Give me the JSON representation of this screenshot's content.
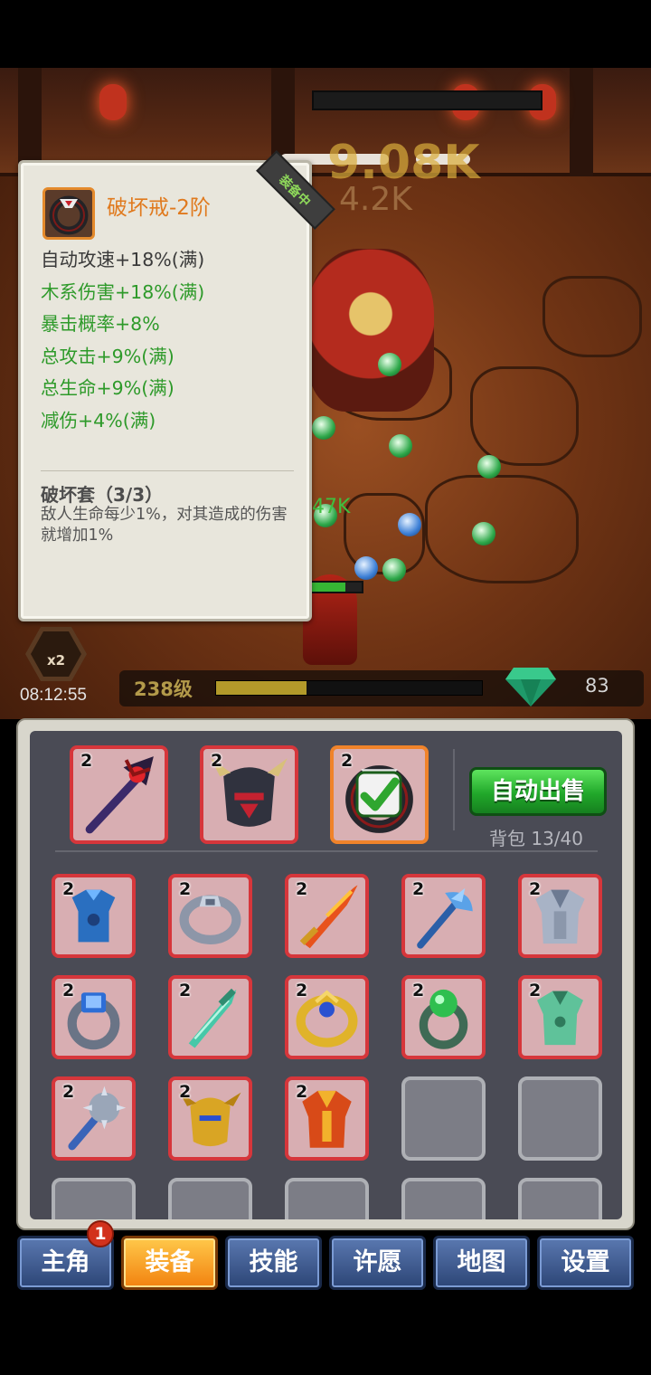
{
  "scene": {
    "damage_text": "9.08K",
    "damage_text_2": "4.2K",
    "hero_damage_text": "47K",
    "speed_label": "x2",
    "timer": "08:12:55",
    "level_label": "238级",
    "exp_progress": 0.34,
    "gem_count": "83"
  },
  "tooltip": {
    "ribbon": "装备中",
    "title": "破坏戒-2阶",
    "stats": [
      {
        "text": "自动攻速+18%(满)",
        "color": "#3a3a3a"
      },
      {
        "text": "木系伤害+18%(满)",
        "color": "#2e9a2a"
      },
      {
        "text": "暴击概率+8%",
        "color": "#2e9a2a"
      },
      {
        "text": "总攻击+9%(满)",
        "color": "#2e9a2a"
      },
      {
        "text": "总生命+9%(满)",
        "color": "#2e9a2a"
      },
      {
        "text": "减伤+4%(满)",
        "color": "#2e9a2a"
      }
    ],
    "set_name": "破坏套（3/3）",
    "set_desc": "敌人生命每少1%，对其造成的伤害就增加1%"
  },
  "inventory": {
    "auto_sell_label": "自动出售",
    "bag_label": "背包 13/40",
    "equipped": [
      {
        "level": "2",
        "icon": "dark-scepter-icon"
      },
      {
        "level": "2",
        "icon": "dark-horned-helmet-icon"
      },
      {
        "level": "2",
        "icon": "destruction-ring-icon",
        "selected": true
      }
    ],
    "items": [
      {
        "level": "2",
        "icon": "blue-armor-icon"
      },
      {
        "level": "2",
        "icon": "silver-ring-icon"
      },
      {
        "level": "2",
        "icon": "flame-sword-icon"
      },
      {
        "level": "2",
        "icon": "ice-axe-icon"
      },
      {
        "level": "2",
        "icon": "steel-armor-icon"
      },
      {
        "level": "2",
        "icon": "sapphire-ring-icon"
      },
      {
        "level": "2",
        "icon": "jade-sword-icon"
      },
      {
        "level": "2",
        "icon": "gold-ring-icon"
      },
      {
        "level": "2",
        "icon": "emerald-ring-icon"
      },
      {
        "level": "2",
        "icon": "jade-armor-icon"
      },
      {
        "level": "2",
        "icon": "spiked-mace-icon"
      },
      {
        "level": "2",
        "icon": "gold-helmet-icon"
      },
      {
        "level": "2",
        "icon": "gold-red-armor-icon"
      }
    ]
  },
  "tabs": [
    {
      "label": "主角",
      "badge": "1"
    },
    {
      "label": "装备",
      "active": true
    },
    {
      "label": "技能"
    },
    {
      "label": "许愿"
    },
    {
      "label": "地图"
    },
    {
      "label": "设置"
    }
  ]
}
